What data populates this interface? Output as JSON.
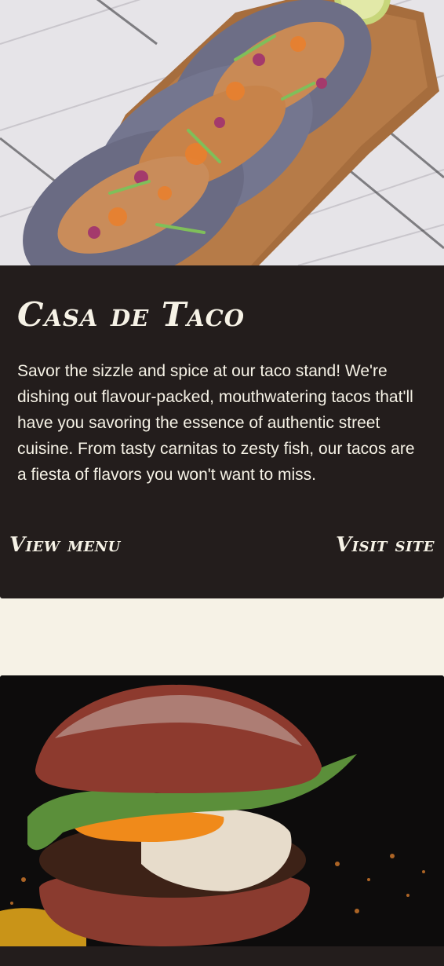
{
  "cards": [
    {
      "image": "tacos-on-wooden-board",
      "title": "Casa de Taco",
      "description": "Savor the sizzle and spice at our taco stand! We're dishing out flavour-packed, mouthwatering tacos that'll have you savoring the essence of authentic street cuisine. From tasty carnitas to zesty fish, our tacos are a fiesta of flavors you won't want to miss.",
      "view_menu_label": "View menu",
      "visit_site_label": "Visit site"
    },
    {
      "image": "burger-on-dark-background"
    }
  ],
  "colors": {
    "page_background": "#f6f2e6",
    "card_background": "#231d1c",
    "text": "#f6f2e6"
  }
}
